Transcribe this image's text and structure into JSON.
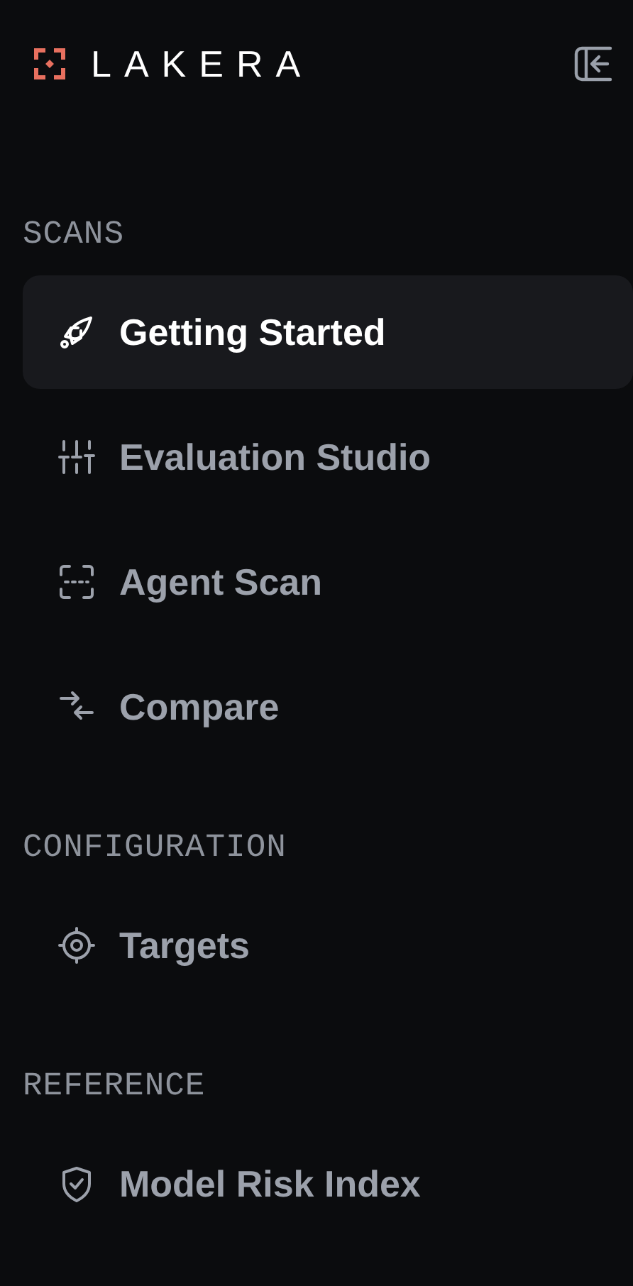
{
  "brand": "LAKERA",
  "sections": [
    {
      "title": "SCANS",
      "items": [
        {
          "label": "Getting Started",
          "selected": true
        },
        {
          "label": "Evaluation Studio",
          "selected": false
        },
        {
          "label": "Agent Scan",
          "selected": false
        },
        {
          "label": "Compare",
          "selected": false
        }
      ]
    },
    {
      "title": "CONFIGURATION",
      "items": [
        {
          "label": "Targets",
          "selected": false
        }
      ]
    },
    {
      "title": "REFERENCE",
      "items": [
        {
          "label": "Model Risk Index",
          "selected": false
        }
      ]
    }
  ]
}
